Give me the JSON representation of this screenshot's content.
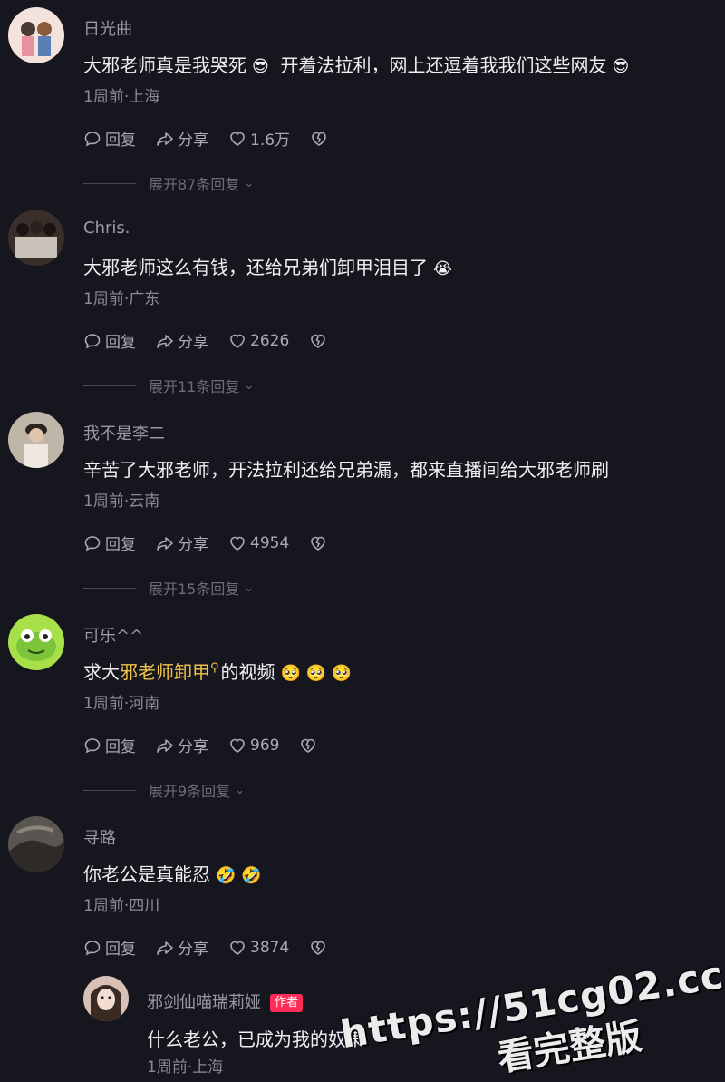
{
  "comments": [
    {
      "username": "日光曲",
      "text": "大邪老师真是我哭死",
      "emoji1": "😎",
      "text2": "开着法拉利，网上还逗着我我们这些网友",
      "emoji2": "😎",
      "meta": "1周前·上海",
      "reply_label": "回复",
      "share_label": "分享",
      "likes": "1.6万",
      "expand": "展开87条回复"
    },
    {
      "username": "Chris.",
      "text": "大邪老师这么有钱，还给兄弟们卸甲泪目了",
      "emoji1": "😭",
      "meta": "1周前·广东",
      "reply_label": "回复",
      "share_label": "分享",
      "likes": "2626",
      "expand": "展开11条回复"
    },
    {
      "username": "我不是李二",
      "text": "辛苦了大邪老师，开法拉利还给兄弟漏，都来直播间给大邪老师刷",
      "meta": "1周前·云南",
      "reply_label": "回复",
      "share_label": "分享",
      "likes": "4954",
      "expand": "展开15条回复"
    },
    {
      "username": "可乐^^",
      "text_pre": "求大",
      "text_link": "邪老师卸甲",
      "text_post": "的视频",
      "emojis": "🥺 🥺 🥺",
      "meta": "1周前·河南",
      "reply_label": "回复",
      "share_label": "分享",
      "likes": "969",
      "expand": "展开9条回复"
    },
    {
      "username": "寻路",
      "text": "你老公是真能忍",
      "emojis": "🤣 🤣",
      "meta": "1周前·四川",
      "reply_label": "回复",
      "share_label": "分享",
      "likes": "3874"
    }
  ],
  "reply": {
    "username": "邪剑仙喵瑞莉娅",
    "badge": "作者",
    "text": "什么老公，已成为我的奴隶",
    "meta": "1周前·上海"
  },
  "watermark": {
    "url": "https://51cg02.cc",
    "sub": "看完整版"
  },
  "colors": {
    "background": "#16161f",
    "highlight": "#f0c24a",
    "author_badge": "#ff2c55"
  },
  "icons": [
    "comment-bubble-icon",
    "share-arrow-icon",
    "heart-icon",
    "broken-heart-icon",
    "chevron-down-icon",
    "search-icon"
  ]
}
